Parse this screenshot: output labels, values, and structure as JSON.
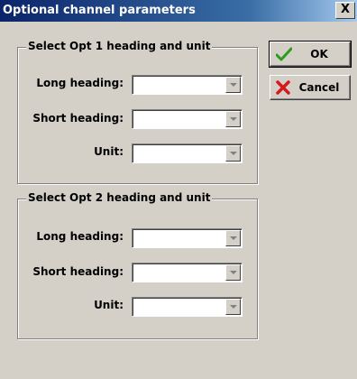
{
  "window": {
    "title": "Optional channel parameters",
    "close_glyph": "X"
  },
  "groups": [
    {
      "title": "Select Opt 1 heading and unit",
      "rows": [
        {
          "label": "Long heading:",
          "value": ""
        },
        {
          "label": "Short heading:",
          "value": ""
        },
        {
          "label": "Unit:",
          "value": ""
        }
      ]
    },
    {
      "title": "Select Opt 2 heading and unit",
      "rows": [
        {
          "label": "Long heading:",
          "value": ""
        },
        {
          "label": "Short heading:",
          "value": ""
        },
        {
          "label": "Unit:",
          "value": ""
        }
      ]
    }
  ],
  "buttons": {
    "ok_label": "OK",
    "ok_icon": "checkmark-icon",
    "cancel_label": "Cancel",
    "cancel_icon": "red-x-icon"
  },
  "colors": {
    "title_bar": "#0a246a",
    "window_bg": "#d4d0c8",
    "ok_check": "#2e9a1e",
    "cancel_x": "#d41a1a"
  }
}
